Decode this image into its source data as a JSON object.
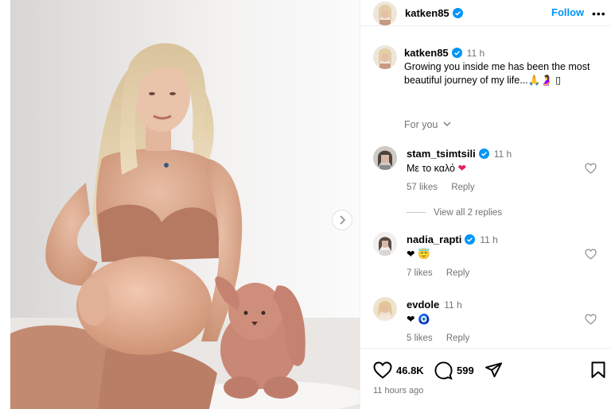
{
  "post": {
    "author": "katken85",
    "follow_label": "Follow",
    "more_label": "•••",
    "next_label": "›"
  },
  "caption": {
    "author": "katken85",
    "time": "11 h",
    "text": "Growing you inside me has been the most beautiful journey of my life...🙏🤰 ▯"
  },
  "for_you": "For you",
  "comments": [
    {
      "author": "stam_tsimtsili",
      "verified": true,
      "time": "11 h",
      "text": "Με το καλό",
      "emoji": "❤",
      "likes": "57 likes",
      "reply": "Reply"
    },
    {
      "author": "nadia_rapti",
      "verified": true,
      "time": "11 h",
      "text": "",
      "emoji": "❤ 😇",
      "likes": "7 likes",
      "reply": "Reply"
    },
    {
      "author": "evdole",
      "verified": false,
      "time": "11 h",
      "text": "",
      "emoji": "❤ 🧿",
      "likes": "5 likes",
      "reply": "Reply"
    }
  ],
  "view_replies": "View all 2 replies",
  "actions": {
    "like_count": "46.8K",
    "comment_count": "599",
    "posted": "11 hours ago"
  },
  "colors": {
    "link_blue": "#0095f6",
    "verified_blue": "#0095f6",
    "heart_red": "#ed4956",
    "meta_gray": "#737373"
  }
}
